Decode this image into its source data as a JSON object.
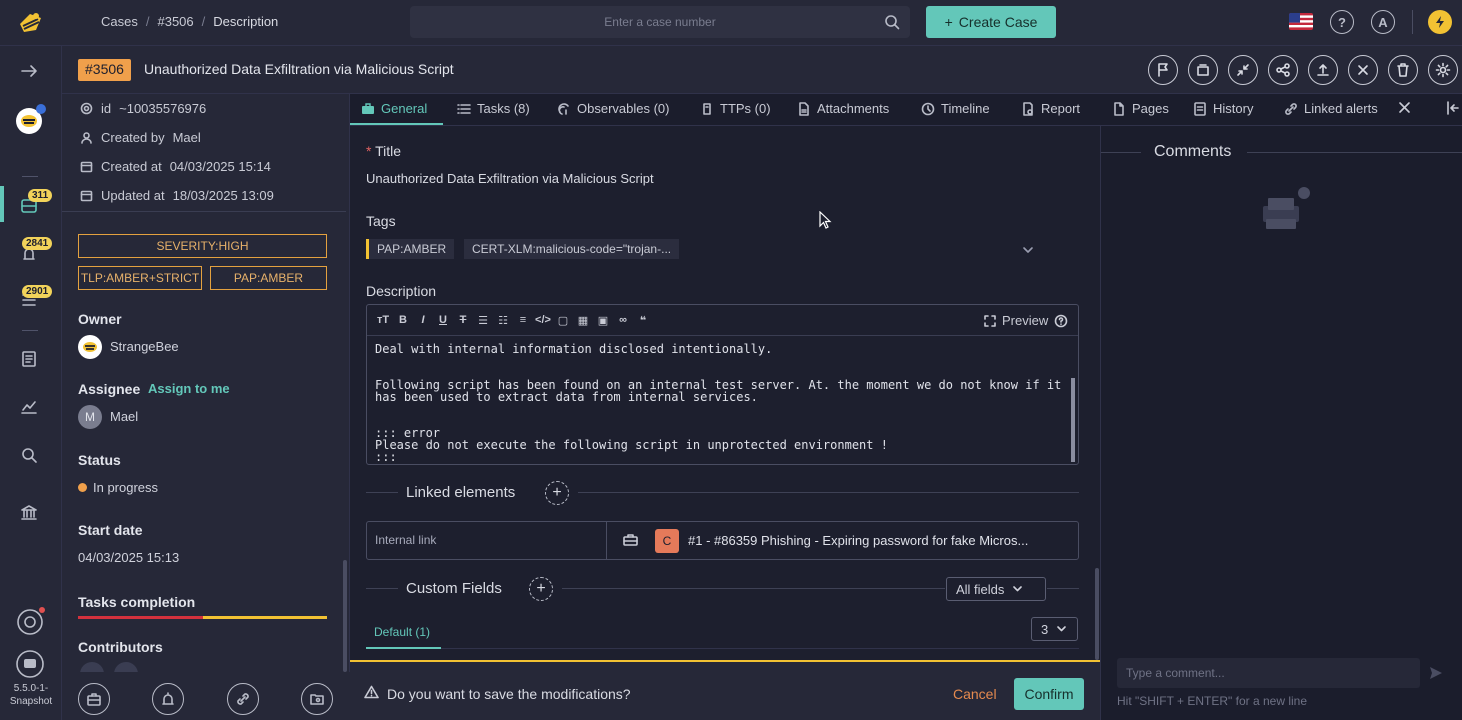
{
  "breadcrumb": {
    "cases": "Cases",
    "case_ref": "#3506",
    "page": "Description",
    "sep": "/"
  },
  "search": {
    "placeholder": "Enter a case number"
  },
  "create_case": {
    "label": "Create Case",
    "plus": "+"
  },
  "top_icons": {
    "help": "?",
    "avatar": "A"
  },
  "nav": {
    "badges": {
      "cases": "311",
      "alerts": "2841",
      "tasks": "2901"
    },
    "version": [
      "5.5.0-1-",
      "Snapshot"
    ]
  },
  "case": {
    "number": "#3506",
    "title": "Unauthorized Data Exfiltration via Malicious Script"
  },
  "meta": {
    "id": "~10035576976",
    "created_by_label": "Created by",
    "created_by": "Mael",
    "created_at_label": "Created at",
    "created_at": "04/03/2025 15:14",
    "updated_at_label": "Updated at",
    "updated_at": "18/03/2025 13:09"
  },
  "panel_tags": {
    "severity": "SEVERITY:HIGH",
    "tlp": "TLP:AMBER+STRICT",
    "pap": "PAP:AMBER"
  },
  "owner": {
    "label": "Owner",
    "value": "StrangeBee"
  },
  "assignee": {
    "label": "Assignee",
    "assign_link": "Assign to me",
    "value": "Mael",
    "initial": "M"
  },
  "status": {
    "label": "Status",
    "value": "In progress",
    "color": "#f0a04b"
  },
  "start_date": {
    "label": "Start date",
    "value": "04/03/2025 15:13"
  },
  "tasks_completion": {
    "label": "Tasks completion",
    "fraction": 0.5
  },
  "contributors": {
    "label": "Contributors"
  },
  "tabs": [
    {
      "label": "General"
    },
    {
      "label": "Tasks (8)"
    },
    {
      "label": "Observables (0)"
    },
    {
      "label": "TTPs (0)"
    },
    {
      "label": "Attachments"
    },
    {
      "label": "Timeline"
    },
    {
      "label": "Report"
    },
    {
      "label": "Pages"
    },
    {
      "label": "History"
    },
    {
      "label": "Linked alerts"
    }
  ],
  "form": {
    "title_label": "Title",
    "required_mark": "*",
    "title_value": "Unauthorized Data Exfiltration via Malicious Script",
    "tags_label": "Tags",
    "tags": [
      "PAP:AMBER",
      "CERT-XLM:malicious-code=\"trojan-..."
    ],
    "description_label": "Description",
    "preview_label": "Preview",
    "description_text": "Deal with internal information disclosed intentionally.\n\n\nFollowing script has been found on an internal test server. At. the moment we do not know if it\nhas been used to extract data from internal services.\n\n\n::: error\nPlease do not execute the following script in unprotected environment !\n:::",
    "linked_elements_label": "Linked elements",
    "link_type": "Internal link",
    "link_badge": "C",
    "link_text": "#1 - #86359 Phishing - Expiring password for fake Micros...",
    "custom_fields_label": "Custom Fields",
    "all_fields": "All fields",
    "default_tab": "Default (1)",
    "page_size": "3"
  },
  "savebar": {
    "question": "Do you want to save the modifications?",
    "cancel": "Cancel",
    "confirm": "Confirm"
  },
  "comments": {
    "title": "Comments",
    "placeholder": "Type a comment...",
    "hint": "Hit \"SHIFT + ENTER\" for a new line"
  },
  "colors": {
    "accent": "#63c7b9",
    "case_badge": "#f0a04b",
    "warning": "#f2c233",
    "danger": "#d3313d"
  }
}
